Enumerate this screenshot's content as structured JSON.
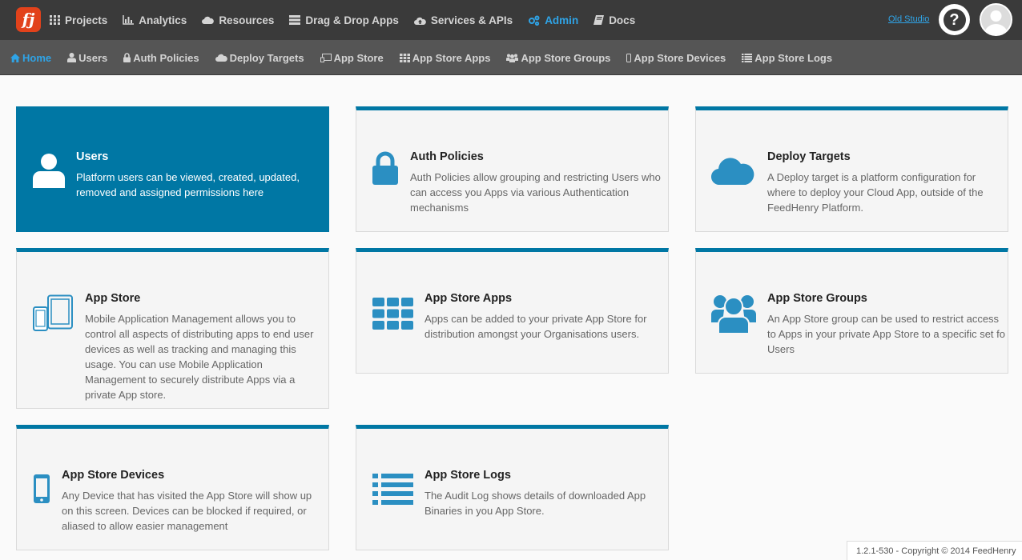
{
  "topnav": {
    "logo": "fj",
    "items": [
      {
        "label": "Projects",
        "icon": "grid-icon",
        "active": false
      },
      {
        "label": "Analytics",
        "icon": "bar-chart-icon",
        "active": false
      },
      {
        "label": "Resources",
        "icon": "cloud-icon",
        "active": false
      },
      {
        "label": "Drag & Drop Apps",
        "icon": "hdd-icon",
        "active": false
      },
      {
        "label": "Services & APIs",
        "icon": "cloud-upload-icon",
        "active": false
      },
      {
        "label": "Admin",
        "icon": "cogs-icon",
        "active": true
      },
      {
        "label": "Docs",
        "icon": "book-icon",
        "active": false
      }
    ],
    "old_studio": "Old Studio",
    "help": "?"
  },
  "subnav": {
    "items": [
      {
        "label": "Home",
        "icon": "home-icon",
        "active": true
      },
      {
        "label": "Users",
        "icon": "user-icon",
        "active": false
      },
      {
        "label": "Auth Policies",
        "icon": "lock-icon",
        "active": false
      },
      {
        "label": "Deploy Targets",
        "icon": "cloud-icon",
        "active": false
      },
      {
        "label": "App Store",
        "icon": "tablet-icon",
        "active": false
      },
      {
        "label": "App Store Apps",
        "icon": "th-icon",
        "active": false
      },
      {
        "label": "App Store Groups",
        "icon": "group-icon",
        "active": false
      },
      {
        "label": "App Store Devices",
        "icon": "mobile-icon",
        "active": false
      },
      {
        "label": "App Store Logs",
        "icon": "list-icon",
        "active": false
      }
    ]
  },
  "tiles": [
    {
      "title": "Users",
      "description": "Platform users can be viewed, created, updated, removed and assigned permissions here",
      "icon": "user-icon"
    },
    {
      "title": "Auth Policies",
      "description": "Auth Policies allow grouping and restricting Users who can access you Apps via various Authentication mechanisms",
      "icon": "lock-icon"
    },
    {
      "title": "Deploy Targets",
      "description": "A Deploy target is a platform configuration for where to deploy your Cloud App, outside of the FeedHenry Platform.",
      "icon": "cloud-icon"
    },
    {
      "title": "App Store",
      "description": "Mobile Application Management allows you to control all aspects of distributing apps to end user devices as well as tracking and managing this usage. You can use Mobile Application Management to securely distribute Apps via a private App store.",
      "icon": "devices-icon"
    },
    {
      "title": "App Store Apps",
      "description": "Apps can be added to your private App Store for distribution amongst your Organisations users.",
      "icon": "th-icon"
    },
    {
      "title": "App Store Groups",
      "description": "An App Store group can be used to restrict access to Apps in your private App Store to a specific set fo Users",
      "icon": "group-icon"
    },
    {
      "title": "App Store Devices",
      "description": "Any Device that has visited the App Store will show up on this screen. Devices can be blocked if required, or aliased to allow easier management",
      "icon": "mobile-icon"
    },
    {
      "title": "App Store Logs",
      "description": "The Audit Log shows details of downloaded App Binaries in you App Store.",
      "icon": "list-icon"
    }
  ],
  "footer": "1.2.1-530 - Copyright © 2014 FeedHenry",
  "colors": {
    "accent": "#2fa4e7",
    "tile_blue": "#0077a4",
    "topbar": "#3a3a3a",
    "subbar": "#555555",
    "logo": "#e2421b"
  }
}
